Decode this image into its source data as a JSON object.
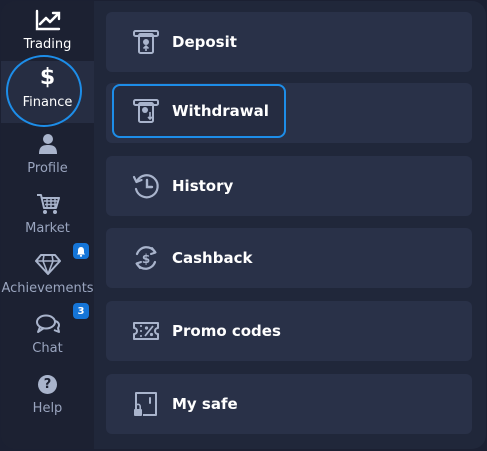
{
  "sidebar": {
    "items": [
      {
        "label": "Trading",
        "icon": "chart-line-icon"
      },
      {
        "label": "Finance",
        "icon": "dollar-icon"
      },
      {
        "label": "Profile",
        "icon": "user-icon"
      },
      {
        "label": "Market",
        "icon": "cart-icon"
      },
      {
        "label": "Achievements",
        "icon": "diamond-icon",
        "badge_icon": "bell-icon"
      },
      {
        "label": "Chat",
        "icon": "chat-icon",
        "badge": "3"
      },
      {
        "label": "Help",
        "icon": "help-icon"
      }
    ],
    "dollar_symbol": "$",
    "help_symbol": "?"
  },
  "menu": {
    "items": [
      {
        "label": "Deposit",
        "icon": "deposit-icon"
      },
      {
        "label": "Withdrawal",
        "icon": "withdrawal-icon",
        "selected": true
      },
      {
        "label": "History",
        "icon": "history-icon"
      },
      {
        "label": "Cashback",
        "icon": "cashback-icon"
      },
      {
        "label": "Promo codes",
        "icon": "promo-code-icon"
      },
      {
        "label": "My safe",
        "icon": "safe-icon"
      }
    ]
  },
  "colors": {
    "accent": "#1d8de8",
    "badge": "#1575d8",
    "icon": "#a9b4cc"
  }
}
